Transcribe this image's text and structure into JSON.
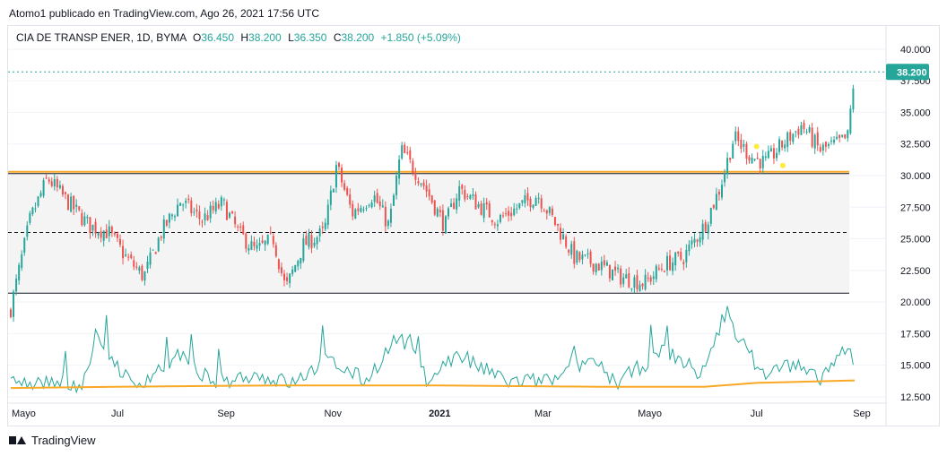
{
  "header": {
    "attribution": "Atomo1 publicado en TradingView.com, Ago 26, 2021 17:56 UTC"
  },
  "legend": {
    "symbol": "CIA DE TRANSP ENER, 1D, BYMA",
    "o_label": "O",
    "o_value": "36.450",
    "h_label": "H",
    "h_value": "38.200",
    "l_label": "L",
    "l_value": "36.350",
    "c_label": "C",
    "c_value": "38.200",
    "change": "+1.850 (+5.09%)"
  },
  "price_axis": {
    "ticks": [
      "40.000",
      "37.500",
      "35.000",
      "32.500",
      "30.000",
      "27.500",
      "25.000",
      "22.500",
      "20.000",
      "17.500",
      "15.000",
      "12.500"
    ],
    "current_price_label": "38.200"
  },
  "time_axis": {
    "ticks": [
      "Mayo",
      "Jul",
      "Sep",
      "Nov",
      "2021",
      "Mar",
      "Mayo",
      "Jul",
      "Sep"
    ]
  },
  "colors": {
    "up": "#26a69a",
    "down": "#ef5350",
    "resistance": "#f9a825",
    "volume_line": "#26a69a",
    "volume_ma": "#f9a825",
    "last_price": "#26a69a"
  },
  "chart_data": {
    "type": "candlestick",
    "ylim": [
      12.5,
      40.0
    ],
    "x_start": "2020-05-01",
    "x_end": "2021-08-26",
    "last": {
      "open": 36.45,
      "high": 38.2,
      "low": 36.35,
      "close": 38.2,
      "change": 1.85,
      "change_pct": 5.09
    },
    "close_path": [
      [
        "2020-05-01",
        19.5
      ],
      [
        "2020-05-12",
        26.5
      ],
      [
        "2020-05-22",
        29.8
      ],
      [
        "2020-06-02",
        28.0
      ],
      [
        "2020-06-15",
        26.0
      ],
      [
        "2020-06-26",
        25.5
      ],
      [
        "2020-07-06",
        23.5
      ],
      [
        "2020-07-16",
        22.0
      ],
      [
        "2020-07-26",
        25.5
      ],
      [
        "2020-08-06",
        28.0
      ],
      [
        "2020-08-18",
        26.5
      ],
      [
        "2020-08-30",
        27.8
      ],
      [
        "2020-09-08",
        25.5
      ],
      [
        "2020-09-18",
        24.0
      ],
      [
        "2020-09-28",
        25.0
      ],
      [
        "2020-10-05",
        21.0
      ],
      [
        "2020-10-15",
        24.5
      ],
      [
        "2020-10-27",
        25.5
      ],
      [
        "2020-11-03",
        30.8
      ],
      [
        "2020-11-12",
        27.0
      ],
      [
        "2020-11-24",
        28.5
      ],
      [
        "2020-12-03",
        26.0
      ],
      [
        "2020-12-10",
        32.0
      ],
      [
        "2020-12-22",
        29.5
      ],
      [
        "2021-01-04",
        26.0
      ],
      [
        "2021-01-12",
        29.0
      ],
      [
        "2021-01-22",
        27.8
      ],
      [
        "2021-02-03",
        26.5
      ],
      [
        "2021-02-15",
        27.5
      ],
      [
        "2021-02-26",
        28.5
      ],
      [
        "2021-03-09",
        26.0
      ],
      [
        "2021-03-19",
        23.5
      ],
      [
        "2021-04-01",
        23.0
      ],
      [
        "2021-04-14",
        22.0
      ],
      [
        "2021-04-28",
        21.5
      ],
      [
        "2021-05-10",
        23.0
      ],
      [
        "2021-05-20",
        23.5
      ],
      [
        "2021-06-01",
        26.0
      ],
      [
        "2021-06-10",
        29.0
      ],
      [
        "2021-06-18",
        33.0
      ],
      [
        "2021-06-28",
        31.5
      ],
      [
        "2021-07-06",
        31.0
      ],
      [
        "2021-07-16",
        32.5
      ],
      [
        "2021-07-27",
        34.0
      ],
      [
        "2021-08-06",
        32.0
      ],
      [
        "2021-08-16",
        32.5
      ],
      [
        "2021-08-22",
        33.0
      ],
      [
        "2021-08-26",
        38.2
      ]
    ],
    "volume_path": [
      [
        "2020-05-01",
        13.3
      ],
      [
        "2020-05-20",
        13.4
      ],
      [
        "2020-06-10",
        13.2
      ],
      [
        "2020-06-20",
        16.8
      ],
      [
        "2020-07-10",
        13.0
      ],
      [
        "2020-08-05",
        15.5
      ],
      [
        "2020-08-25",
        13.3
      ],
      [
        "2020-09-15",
        14.0
      ],
      [
        "2020-10-10",
        13.3
      ],
      [
        "2020-10-28",
        15.2
      ],
      [
        "2020-11-20",
        13.5
      ],
      [
        "2020-12-05",
        16.5
      ],
      [
        "2020-12-10",
        17.0
      ],
      [
        "2020-12-25",
        13.6
      ],
      [
        "2021-01-10",
        15.5
      ],
      [
        "2021-02-10",
        13.4
      ],
      [
        "2021-03-10",
        13.6
      ],
      [
        "2021-03-28",
        15.3
      ],
      [
        "2021-04-12",
        13.3
      ],
      [
        "2021-05-10",
        16.0
      ],
      [
        "2021-05-30",
        14.0
      ],
      [
        "2021-06-12",
        18.0
      ],
      [
        "2021-06-15",
        19.5
      ],
      [
        "2021-06-20",
        17.0
      ],
      [
        "2021-07-05",
        14.0
      ],
      [
        "2021-07-20",
        14.8
      ],
      [
        "2021-08-05",
        13.6
      ],
      [
        "2021-08-18",
        15.5
      ],
      [
        "2021-08-24",
        15.8
      ],
      [
        "2021-08-26",
        13.6
      ]
    ],
    "volume_ma_path": [
      [
        "2020-05-01",
        13.2
      ],
      [
        "2020-07-01",
        13.3
      ],
      [
        "2020-10-01",
        13.4
      ],
      [
        "2021-01-01",
        13.4
      ],
      [
        "2021-04-01",
        13.3
      ],
      [
        "2021-06-01",
        13.3
      ],
      [
        "2021-07-01",
        13.6
      ],
      [
        "2021-08-26",
        13.8
      ]
    ],
    "annotations": {
      "range_box": {
        "from": "2020-05-01",
        "to": "2021-08-26",
        "top": 30.2,
        "bottom": 20.7
      },
      "resistance_line": 30.3,
      "midline": 25.5,
      "support_line": 20.7,
      "last_price_line": 38.2
    }
  }
}
